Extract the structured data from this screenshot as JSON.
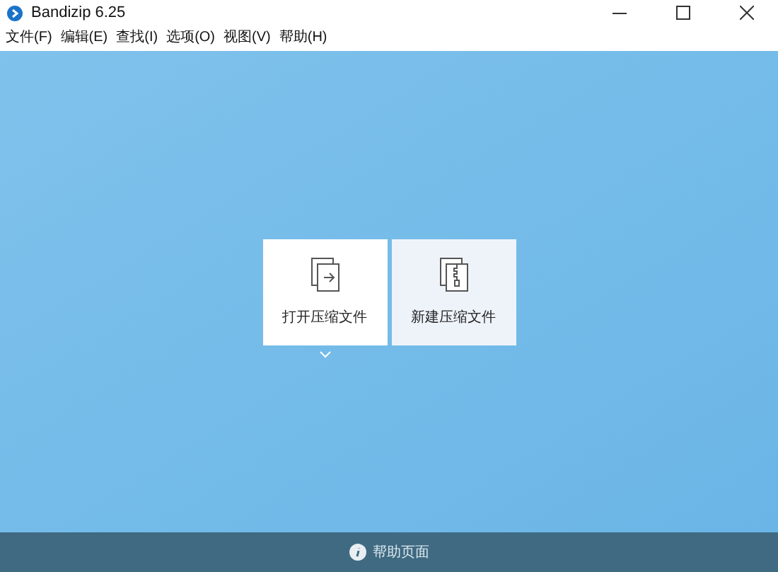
{
  "window": {
    "title": "Bandizip 6.25"
  },
  "menu": [
    "文件(F)",
    "编辑(E)",
    "查找(I)",
    "选项(O)",
    "视图(V)",
    "帮助(H)"
  ],
  "actions": [
    {
      "label": "打开压缩文件",
      "kind": "open",
      "selected": false
    },
    {
      "label": "新建压缩文件",
      "kind": "new",
      "selected": true
    }
  ],
  "footer": {
    "label": "帮助页面"
  }
}
